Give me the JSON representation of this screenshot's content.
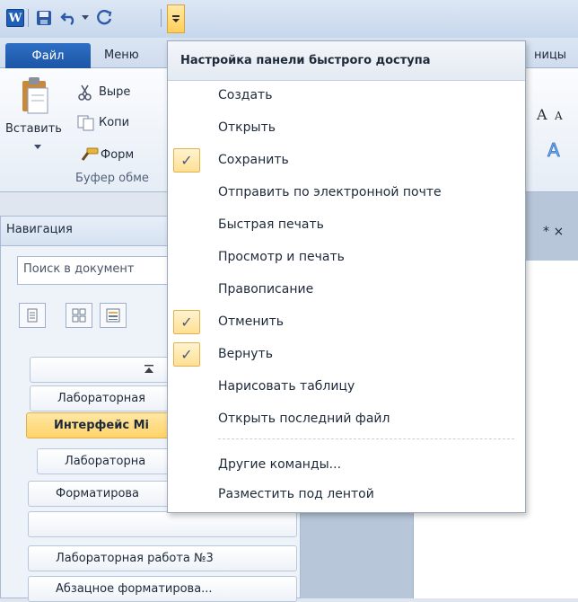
{
  "qat": {
    "logo_letter": "W",
    "icons": [
      "word-logo-icon",
      "save-icon",
      "undo-icon",
      "redo-icon",
      "customize-qat-icon"
    ]
  },
  "tabs": {
    "file": "Файл",
    "menu": "Меню",
    "pages_partial": "ницы"
  },
  "ribbon": {
    "paste": "Вставить",
    "cut_partial": "Выре",
    "copy_partial": "Копи",
    "format_partial": "Форм",
    "clipboard_group_partial": "Буфер обме"
  },
  "nav": {
    "title": "Навигация",
    "search_placeholder": "Поиск в документ",
    "headings": [
      {
        "text": "Лабораторная"
      },
      {
        "text": "Интерфейс Mi",
        "selected": true
      },
      {
        "text": "Лабораторна"
      },
      {
        "text": "Форматирова"
      },
      {
        "text": ""
      },
      {
        "text": "Лабораторная работа №3"
      },
      {
        "text": "Абзацное форматирова..."
      }
    ]
  },
  "doc": {
    "tab_marks": "* ×"
  },
  "menu": {
    "title": "Настройка панели быстрого доступа",
    "items": [
      {
        "label": "Создать",
        "checked": false
      },
      {
        "label": "Открыть",
        "checked": false
      },
      {
        "label": "Сохранить",
        "checked": true
      },
      {
        "label": "Отправить по электронной почте",
        "checked": false
      },
      {
        "label": "Быстрая печать",
        "checked": false
      },
      {
        "label": "Просмотр и печать",
        "checked": false
      },
      {
        "label": "Правописание",
        "checked": false
      },
      {
        "label": "Отменить",
        "checked": true
      },
      {
        "label": "Вернуть",
        "checked": true
      },
      {
        "label": "Нарисовать таблицу",
        "checked": false
      },
      {
        "label": "Открыть последний файл",
        "checked": false
      }
    ],
    "more_commands": "Другие команды...",
    "below_ribbon": "Разместить под лентой",
    "check_glyph": "✓"
  }
}
